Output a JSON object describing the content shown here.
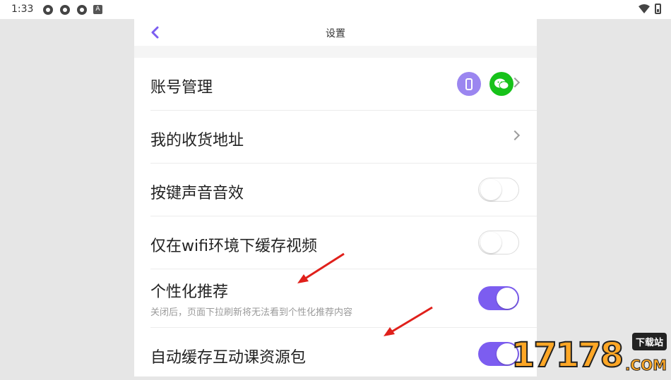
{
  "status_bar": {
    "time": "1:33",
    "left_icons": [
      "settings-gear-icon",
      "settings-gear-icon",
      "settings-gear-icon",
      "a-notification-icon"
    ],
    "right_icons": [
      "wifi-icon",
      "battery-icon"
    ]
  },
  "header": {
    "title": "设置",
    "back_icon": "chevron-left-icon",
    "accent_color": "#7c5df0"
  },
  "settings": {
    "account": {
      "label": "账号管理",
      "icons": [
        "phone-icon",
        "wechat-icon"
      ]
    },
    "address": {
      "label": "我的收货地址"
    },
    "key_sound": {
      "label": "按键声音音效",
      "enabled": false
    },
    "wifi_cache": {
      "label": "仅在wifi环境下缓存视频",
      "enabled": false
    },
    "personalized": {
      "label": "个性化推荐",
      "sub": "关闭后，页面下拉刷新将无法看到个性化推荐内容",
      "enabled": true
    },
    "auto_cache": {
      "label": "自动缓存互动课资源包",
      "enabled": true
    }
  },
  "watermark": {
    "digits": "17178",
    "tag": "下载站",
    "suffix": ".COM"
  }
}
